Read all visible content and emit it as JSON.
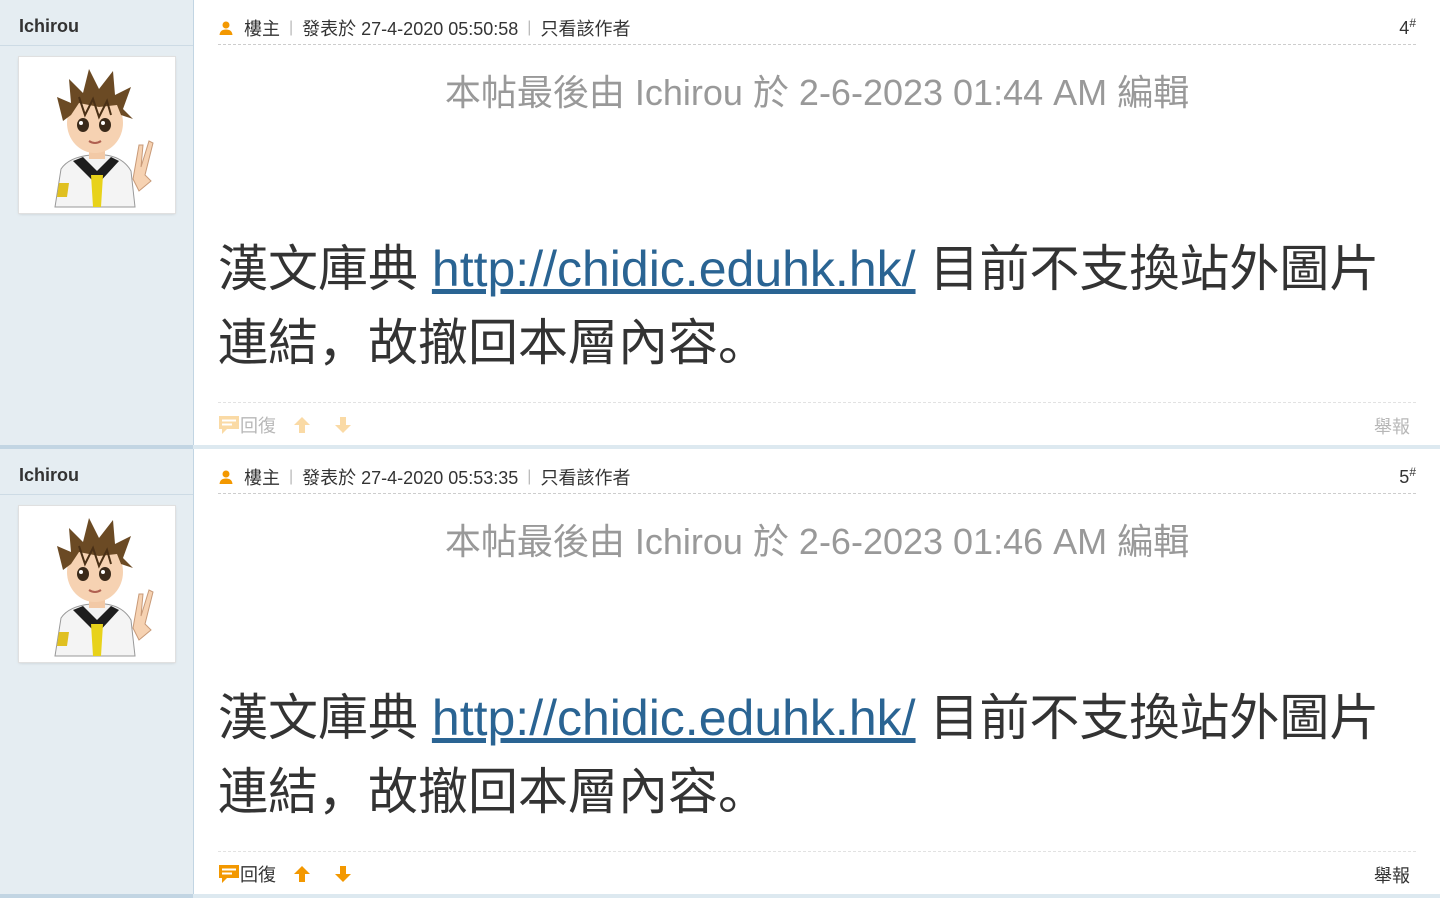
{
  "posts": [
    {
      "author": "Ichirou",
      "role": "樓主",
      "posted": "發表於 27-4-2020 05:50:58",
      "only_author": "只看該作者",
      "floor": "4",
      "floor_mark": "#",
      "edit_note": "本帖最後由 Ichirou 於 2-6-2023 01:44 AM 編輯",
      "body_before": "漢文庫典 ",
      "body_link": "http://chidic.eduhk.hk/",
      "body_after": " 目前不支換站外圖片連結，故撤回本層內容。",
      "reply_label": "回復",
      "report_label": "舉報"
    },
    {
      "author": "Ichirou",
      "role": "樓主",
      "posted": "發表於 27-4-2020 05:53:35",
      "only_author": "只看該作者",
      "floor": "5",
      "floor_mark": "#",
      "edit_note": "本帖最後由 Ichirou 於 2-6-2023 01:46 AM 編輯",
      "body_before": "漢文庫典 ",
      "body_link": "http://chidic.eduhk.hk/",
      "body_after": " 目前不支換站外圖片連結，故撤回本層內容。",
      "reply_label": "回復",
      "report_label": "舉報"
    }
  ],
  "colors": {
    "accent": "#f39800",
    "link": "#2a6493",
    "sidebar": "#e5edf2",
    "border": "#c2d5e3"
  },
  "icons": {
    "user": "user-icon",
    "reply": "reply-icon",
    "up": "arrow-up-icon",
    "down": "arrow-down-icon"
  }
}
